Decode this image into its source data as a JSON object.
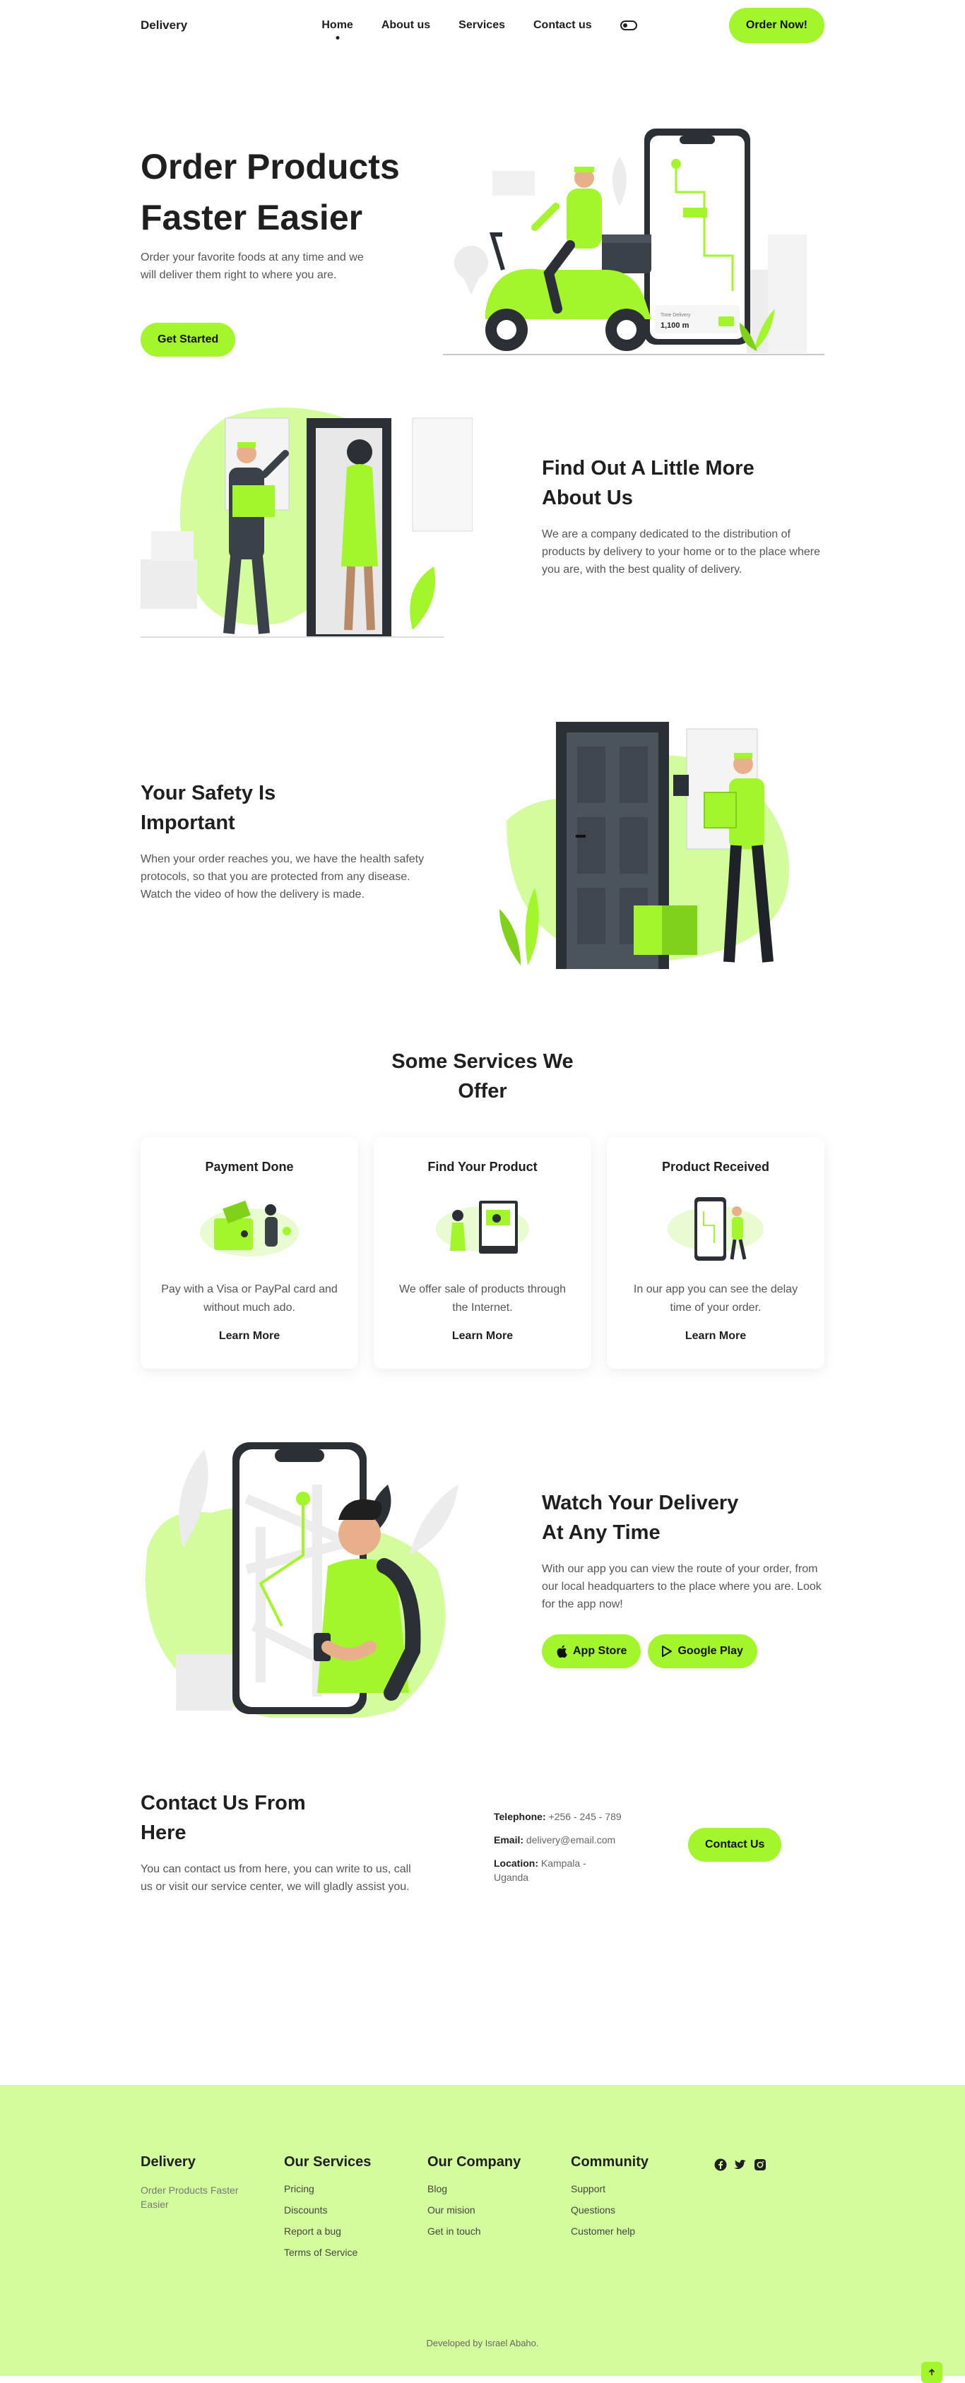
{
  "nav": {
    "logo": "Delivery",
    "links": [
      "Home",
      "About us",
      "Services",
      "Contact us"
    ],
    "order_button": "Order Now!"
  },
  "hero": {
    "title_line1": "Order Products",
    "title_line2": "Faster Easier",
    "description": "Order your favorite foods at any time and we will deliver them right to where you are.",
    "button": "Get Started",
    "phone_label": "Time Delivery",
    "phone_value": "1,100 m"
  },
  "about": {
    "title_line1": "Find Out A Little More",
    "title_line2": "About Us",
    "description": "We are a company dedicated to the distribution of products by delivery to your home or to the place where you are, with the best quality of delivery."
  },
  "safety": {
    "title_line1": "Your Safety Is",
    "title_line2": "Important",
    "description": "When your order reaches you, we have the health safety protocols, so that you are protected from any disease. Watch the video of how the delivery is made."
  },
  "services": {
    "title_line1": "Some Services We",
    "title_line2": "Offer",
    "cards": [
      {
        "title": "Payment Done",
        "description": "Pay with a Visa or PayPal card and without much ado.",
        "link": "Learn More"
      },
      {
        "title": "Find Your Product",
        "description": "We offer sale of products through the Internet.",
        "link": "Learn More"
      },
      {
        "title": "Product Received",
        "description": "In our app you can see the delay time of your order.",
        "link": "Learn More"
      }
    ]
  },
  "app": {
    "title_line1": "Watch Your Delivery",
    "title_line2": "At Any Time",
    "description": "With our app you can view the route of your order, from our local headquarters to the place where you are. Look for the app now!",
    "app_store": "App Store",
    "google_play": "Google Play"
  },
  "contact": {
    "title_line1": "Contact Us From",
    "title_line2": "Here",
    "description": "You can contact us from here, you can write to us, call us or visit our service center, we will gladly assist you.",
    "telephone_label": "Telephone:",
    "telephone": "+256 - 245 - 789",
    "email_label": "Email:",
    "email": "delivery@email.com",
    "location_label": "Location:",
    "location": "Kampala - Uganda",
    "button": "Contact Us"
  },
  "footer": {
    "brand": "Delivery",
    "brand_sub": "Order Products Faster Easier",
    "services_title": "Our Services",
    "services": [
      "Pricing",
      "Discounts",
      "Report a bug",
      "Terms of Service"
    ],
    "company_title": "Our Company",
    "company": [
      "Blog",
      "Our mision",
      "Get in touch"
    ],
    "community_title": "Community",
    "community": [
      "Support",
      "Questions",
      "Customer help"
    ],
    "credit": "Developed by Israel Abaho."
  },
  "colors": {
    "accent": "#a3f52c",
    "footer_bg": "#d3fc9c",
    "dark": "#1f1f1f"
  }
}
